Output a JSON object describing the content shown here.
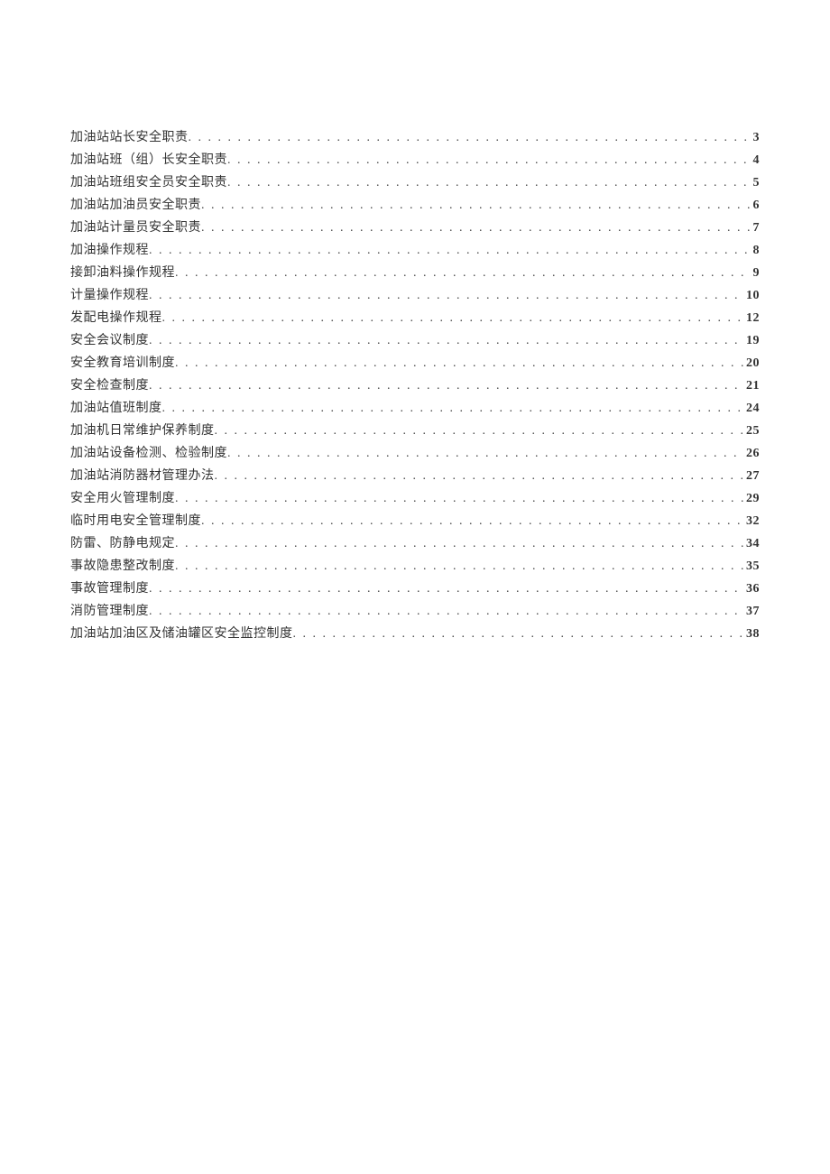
{
  "toc": [
    {
      "title": "加油站站长安全职责",
      "page": "3"
    },
    {
      "title": "加油站班（组）长安全职责",
      "page": "4"
    },
    {
      "title": "加油站班组安全员安全职责",
      "page": "5"
    },
    {
      "title": "加油站加油员安全职责",
      "page": "6"
    },
    {
      "title": "加油站计量员安全职责",
      "page": "7"
    },
    {
      "title": "加油操作规程",
      "page": "8"
    },
    {
      "title": "接卸油料操作规程",
      "page": "9"
    },
    {
      "title": "计量操作规程",
      "page": "10"
    },
    {
      "title": "发配电操作规程",
      "page": "12"
    },
    {
      "title": "安全会议制度",
      "page": "19"
    },
    {
      "title": "安全教育培训制度",
      "page": "20"
    },
    {
      "title": "安全检查制度",
      "page": "21"
    },
    {
      "title": "加油站值班制度",
      "page": "24"
    },
    {
      "title": "加油机日常维护保养制度",
      "page": "25"
    },
    {
      "title": "加油站设备检测、检验制度",
      "page": "26"
    },
    {
      "title": "加油站消防器材管理办法",
      "page": "27"
    },
    {
      "title": "安全用火管理制度",
      "page": "29"
    },
    {
      "title": "临时用电安全管理制度",
      "page": "32"
    },
    {
      "title": "防雷、防静电规定",
      "page": "34"
    },
    {
      "title": "事故隐患整改制度",
      "page": "35"
    },
    {
      "title": "事故管理制度",
      "page": "36"
    },
    {
      "title": "消防管理制度",
      "page": "37"
    },
    {
      "title": "加油站加油区及储油罐区安全监控制度",
      "page": "38"
    }
  ]
}
